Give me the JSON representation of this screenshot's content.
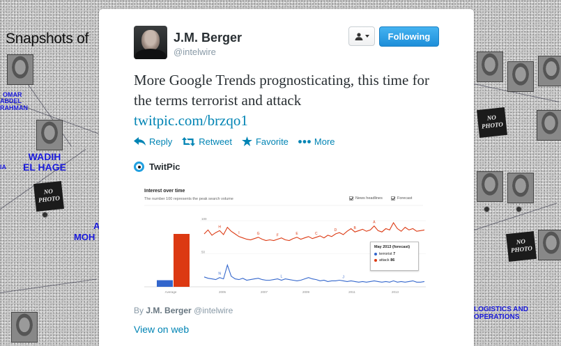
{
  "background": {
    "title": "Snapshots of",
    "labels_left": [
      "OMAR",
      "ABDEL",
      "RAHMAN"
    ],
    "wadih": [
      "WADIH",
      "EL HAGE"
    ],
    "fragments": [
      "A",
      "MOH",
      "IA"
    ],
    "logistics": [
      "LOGISTICS AND",
      "OPERATIONS"
    ],
    "nophoto": [
      "NO",
      "PHOTO"
    ]
  },
  "tweet": {
    "author": {
      "name": "J.M. Berger",
      "handle": "@intelwire"
    },
    "follow_label": "Following",
    "text": "More Google Trends prognosticating, this time for the terms terrorist and attack",
    "link": "twitpic.com/brzqo1",
    "actions": {
      "reply": "Reply",
      "retweet": "Retweet",
      "favorite": "Favorite",
      "more": "More"
    },
    "provider": "TwitPic",
    "byline_prefix": "By",
    "byline_name": "J.M. Berger",
    "byline_handle": "@intelwire",
    "view_on_web": "View on web"
  },
  "colors": {
    "link_blue": "#0084b4",
    "follow_blue": "#1d8ed9",
    "series_terrorist": "#3366cc",
    "series_attack": "#dc3912"
  },
  "chart_data": {
    "type": "line",
    "title": "Interest over time",
    "subtitle": "The number 100 represents the peak search volume",
    "options": [
      "News headlines",
      "Forecast"
    ],
    "x_tick_labels": [
      "Average",
      "2005",
      "2007",
      "2009",
      "2011",
      "2013"
    ],
    "y_tick_labels": [
      "100",
      "50"
    ],
    "ylim": [
      0,
      100
    ],
    "average": {
      "categories": [
        "terrorist",
        "attack"
      ],
      "values": [
        10,
        80
      ]
    },
    "series": [
      {
        "name": "terrorist",
        "values": [
          15,
          13,
          12,
          11,
          14,
          12,
          33,
          16,
          12,
          11,
          13,
          10,
          11,
          12,
          13,
          11,
          10,
          10,
          11,
          12,
          10,
          12,
          11,
          10,
          9,
          10,
          12,
          14,
          12,
          11,
          9,
          10,
          8,
          9,
          9,
          10,
          9,
          8,
          9,
          8,
          7,
          8,
          7,
          8,
          9,
          8,
          7,
          8,
          7,
          9,
          7,
          8,
          7,
          8,
          9,
          7,
          7,
          8
        ]
      },
      {
        "name": "attack",
        "values": [
          80,
          86,
          78,
          82,
          85,
          79,
          90,
          84,
          80,
          76,
          74,
          72,
          71,
          73,
          75,
          72,
          70,
          71,
          70,
          72,
          74,
          71,
          70,
          73,
          75,
          72,
          74,
          76,
          73,
          75,
          77,
          74,
          78,
          76,
          80,
          82,
          79,
          84,
          88,
          83,
          85,
          87,
          84,
          86,
          92,
          85,
          83,
          88,
          86,
          97,
          88,
          84,
          90,
          86,
          88,
          84,
          85,
          86
        ]
      }
    ],
    "news_markers_attack": [
      "H",
      "I",
      "G",
      "F",
      "E",
      "C",
      "D",
      "B",
      "A"
    ],
    "news_markers_terrorist": [
      "N",
      "L",
      "J"
    ],
    "tooltip": {
      "title": "May 2013 (forecast)",
      "rows": [
        {
          "name": "terrorist",
          "value": "7"
        },
        {
          "name": "attack",
          "value": "86"
        }
      ]
    }
  }
}
